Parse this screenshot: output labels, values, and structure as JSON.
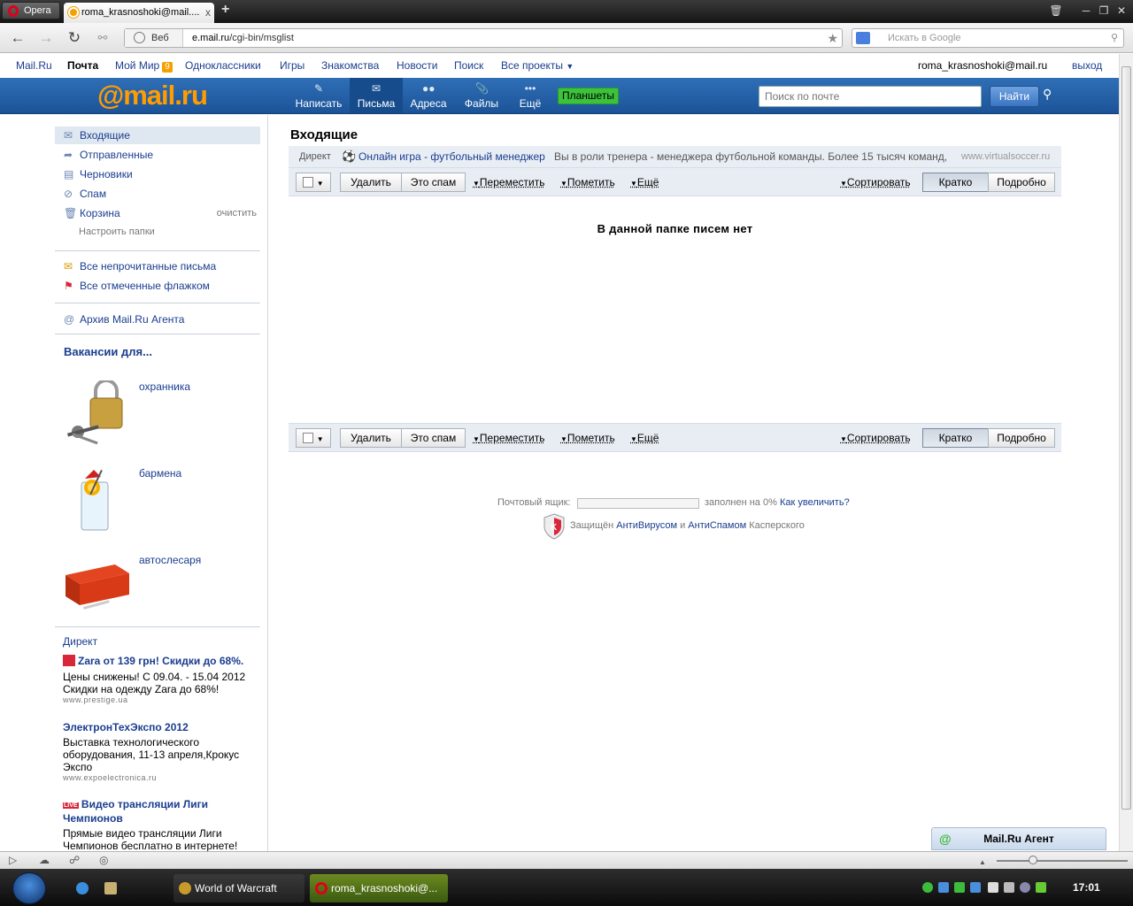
{
  "browser": {
    "menu_label": "Opera",
    "tab_title": "roma_krasnoshoki@mail....",
    "tab_close": "x",
    "new_tab": "+",
    "address_mode": "Веб",
    "url_host": "e.mail.ru",
    "url_path": "/cgi-bin/msglist",
    "search_placeholder": "Искать в Google"
  },
  "topnav": {
    "links": [
      "Mail.Ru",
      "Почта",
      "Мой Мир",
      "Одноклассники",
      "Игры",
      "Знакомства",
      "Новости",
      "Поиск",
      "Все проекты"
    ],
    "myworld_badge": "9",
    "user_email": "roma_krasnoshoki@mail.ru",
    "logout": "выход"
  },
  "header": {
    "logo_at": "@",
    "logo_text": "mail.ru",
    "buttons": [
      "Написать",
      "Письма",
      "Адреса",
      "Файлы",
      "Ещё"
    ],
    "tablets": "Планшеты",
    "search_placeholder": "Поиск по почте",
    "search_button": "Найти"
  },
  "sidebar": {
    "folders": [
      "Входящие",
      "Отправленные",
      "Черновики",
      "Спам",
      "Корзина"
    ],
    "clear": "очистить",
    "configure": "Настроить папки",
    "unread": "Все непрочитанные письма",
    "flagged": "Все отмеченные флажком",
    "agent_archive": "Архив Mail.Ru Агента",
    "vacancies_title": "Вакансии для...",
    "vacancies": [
      "охранника",
      "бармена",
      "автослесаря"
    ],
    "direct_label": "Директ",
    "ads": [
      {
        "title": "Zara от 139 грн! Скидки до 68%.",
        "text": "Цены снижены! С 09.04. - 15.04 2012 Скидки на одежду Zara до 68%!",
        "url": "www.prestige.ua"
      },
      {
        "title": "ЭлектронТехЭкспо 2012",
        "text": "Выставка технологического оборудования, 11-13 апреля,Крокус Экспо",
        "url": "www.expoelectronica.ru"
      },
      {
        "title": "Видео трансляции Лиги Чемпионов",
        "text": "Прямые видео трансляции Лиги Чемпионов бесплатно в интернете!",
        "badge": "LIVE"
      }
    ]
  },
  "main": {
    "title": "Входящие",
    "ad": {
      "label": "Директ",
      "link": "Онлайн игра - футбольный менеджер",
      "text": "Вы в роли тренера - менеджера футбольной команды. Более 15 тысяч команд,",
      "url": "www.virtualsoccer.ru"
    },
    "toolbar": {
      "delete": "Удалить",
      "spam": "Это спам",
      "move": "Переместить",
      "mark": "Пометить",
      "more": "Ещё",
      "sort": "Сортировать",
      "brief": "Кратко",
      "detailed": "Подробно"
    },
    "empty_message": "В данной папке писем нет",
    "quota": {
      "label": "Почтовый ящик:",
      "filled_text": "заполнен на 0%",
      "fill_percent": 0,
      "increase": "Как увеличить?"
    },
    "kaspersky": {
      "prefix": "Защищён",
      "antivirus": "АнтиВирусом",
      "and": "и",
      "antispam": "АнтиСпамом",
      "suffix": "Касперского"
    }
  },
  "agent": {
    "label": "Mail.Ru Агент"
  },
  "taskbar": {
    "items": [
      "World of Warcraft",
      "roma_krasnoshoki@..."
    ],
    "clock": "17:01"
  },
  "colors": {
    "header_blue": "#2f6fb6",
    "logo_orange": "#ff9c00",
    "link_blue": "#1a3d8f",
    "tablets_green": "#3cc23c"
  }
}
